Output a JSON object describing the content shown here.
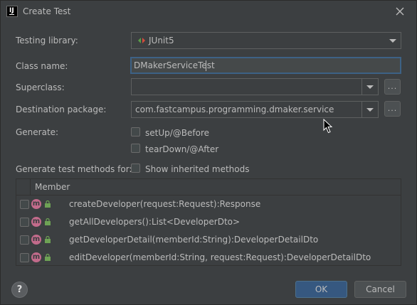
{
  "window": {
    "title": "Create Test"
  },
  "form": {
    "testing_library_label": "Testing library:",
    "testing_library_value": "JUnit5",
    "class_name_label": "Class name:",
    "class_name_value": "DMakerServiceTest",
    "superclass_label": "Superclass:",
    "superclass_value": "",
    "destination_label": "Destination package:",
    "destination_value": "com.fastcampus.programming.dmaker.service",
    "browse_label": "...",
    "generate_label": "Generate:",
    "setup_label": "setUp/@Before",
    "teardown_label": "tearDown/@After",
    "methods_label": "Generate test methods for:",
    "inherited_label": "Show inherited methods"
  },
  "members": {
    "header": "Member",
    "icon_letter": "m",
    "rows": [
      "createDeveloper(request:Request):Response",
      "getAllDevelopers():List<DeveloperDto>",
      "getDeveloperDetail(memberId:String):DeveloperDetailDto",
      "editDeveloper(memberId:String, request:Request):DeveloperDetailDto"
    ]
  },
  "buttons": {
    "help": "?",
    "ok": "OK",
    "cancel": "Cancel"
  },
  "icons": {
    "app": "intellij-icon",
    "close": "close-icon",
    "library": "junit-icon",
    "method": "method-icon",
    "visibility": "lock-icon",
    "dropdown": "chevron-down-icon",
    "cursor": "mouse-cursor-icon"
  },
  "colors": {
    "background": "#3c3f41",
    "text": "#bbbbbb",
    "focus_border": "#3d6185",
    "ok_button": "#365880",
    "method_icon": "#c26b8b",
    "lock_icon": "#6ea255"
  }
}
